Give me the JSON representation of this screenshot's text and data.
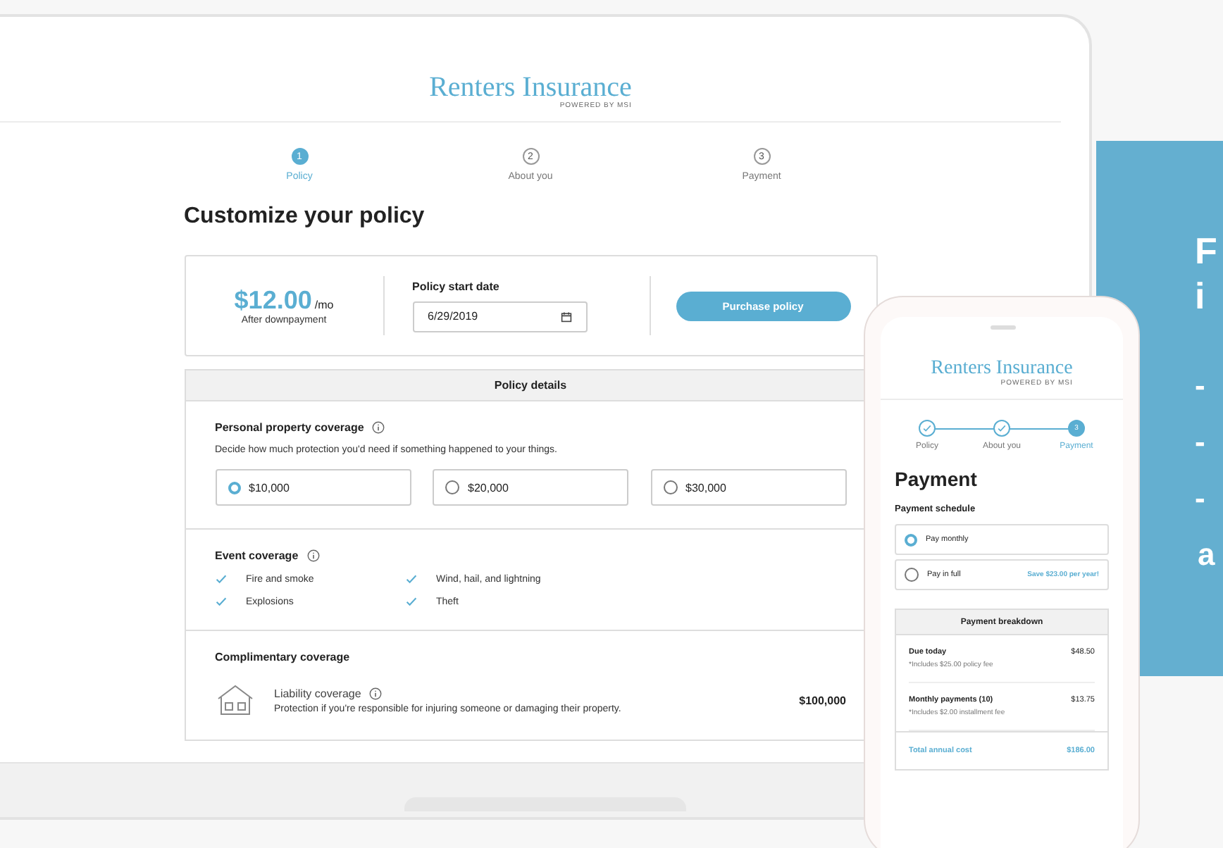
{
  "laptop": {
    "brand": "Renters Insurance",
    "brand_sub": "POWERED BY MSI",
    "steps": [
      {
        "number": "1",
        "label": "Policy",
        "selected": true
      },
      {
        "number": "2",
        "label": "About you",
        "selected": false
      },
      {
        "number": "3",
        "label": "Payment",
        "selected": false
      }
    ],
    "heading": "Customize your policy",
    "summary": {
      "price": "$12.00",
      "unit": "/mo",
      "note": "After downpayment",
      "date_label": "Policy start date",
      "date_value": "6/29/2019",
      "button": "Purchase policy"
    },
    "details": {
      "title": "Policy details",
      "property": {
        "title": "Personal property coverage",
        "description": "Decide how much protection you'd need if something happened to your things.",
        "options": [
          {
            "label": "$10,000",
            "selected": true
          },
          {
            "label": "$20,000",
            "selected": false
          },
          {
            "label": "$30,000",
            "selected": false
          }
        ]
      },
      "events": {
        "title": "Event coverage",
        "items": [
          "Fire and smoke",
          "Wind, hail, and lightning",
          "Explosions",
          "Theft"
        ]
      },
      "complimentary": {
        "title": "Complimentary coverage",
        "items": [
          {
            "title": "Liability coverage",
            "description": "Protection if you're responsible for injuring someone or damaging their property.",
            "amount": "$100,000"
          }
        ]
      }
    }
  },
  "promo": {
    "title_lines": [
      "F",
      "i"
    ],
    "bullets": [
      "-",
      "-",
      "-"
    ],
    "trailing": "a"
  },
  "phone": {
    "brand": "Renters Insurance",
    "brand_sub": "POWERED BY MSI",
    "steps": [
      {
        "label": "Policy",
        "completed": true,
        "selected": false
      },
      {
        "label": "About you",
        "completed": true,
        "selected": false
      },
      {
        "label": "Payment",
        "number": "3",
        "completed": false,
        "selected": true
      }
    ],
    "heading": "Payment",
    "schedule_title": "Payment schedule",
    "options": [
      {
        "label": "Pay monthly",
        "selected": true
      },
      {
        "label": "Pay in full",
        "selected": false,
        "note": "Save $23.00 per year!"
      }
    ],
    "breakdown": {
      "title": "Payment breakdown",
      "rows": [
        {
          "title": "Due today",
          "note": "*Includes $25.00 policy fee",
          "amount": "$48.50"
        },
        {
          "title": "Monthly payments (10)",
          "note": "*Includes $2.00 installment fee",
          "amount": "$13.75"
        }
      ],
      "total_label": "Total annual cost",
      "total_amount": "$186.00"
    }
  }
}
